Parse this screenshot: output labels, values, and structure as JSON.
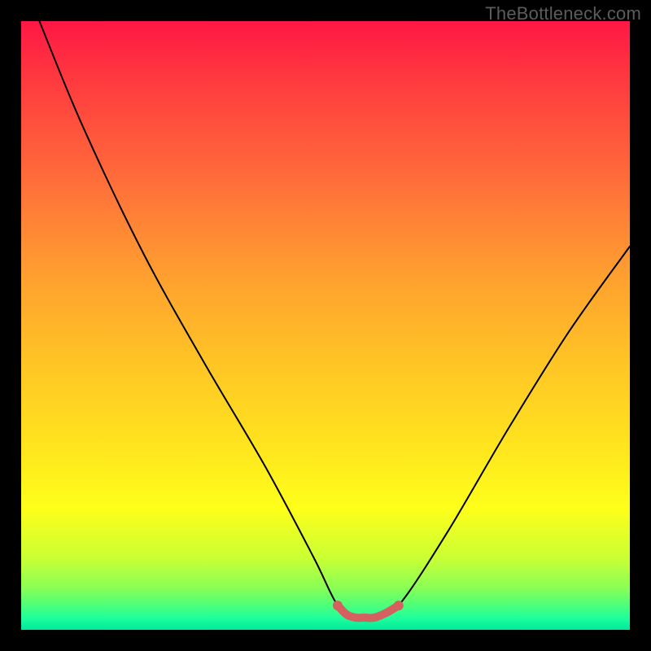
{
  "attribution": "TheBottleneck.com",
  "chart_data": {
    "type": "line",
    "title": "",
    "xlabel": "",
    "ylabel": "",
    "xlim": [
      0,
      100
    ],
    "ylim": [
      0,
      100
    ],
    "grid": false,
    "legend": false,
    "series": [
      {
        "name": "curve",
        "color": "#000000",
        "x": [
          3,
          10,
          20,
          30,
          40,
          48,
          52,
          55,
          58,
          62,
          70,
          80,
          90,
          100
        ],
        "y": [
          100,
          83,
          62,
          44,
          27,
          12,
          4,
          2,
          2,
          4,
          16,
          33,
          49,
          63
        ]
      },
      {
        "name": "highlight-segment",
        "color": "#d46060",
        "thick": true,
        "x": [
          52,
          53.5,
          55,
          56.5,
          58,
          60,
          62
        ],
        "y": [
          4,
          2.5,
          2,
          2,
          2,
          2.8,
          4
        ]
      }
    ],
    "gradient_stops": [
      {
        "pos": 0,
        "color": "#ff1744"
      },
      {
        "pos": 20,
        "color": "#ff5a3c"
      },
      {
        "pos": 42,
        "color": "#ffa02f"
      },
      {
        "pos": 68,
        "color": "#ffe01f"
      },
      {
        "pos": 88,
        "color": "#ccff33"
      },
      {
        "pos": 100,
        "color": "#00e89a"
      }
    ]
  }
}
